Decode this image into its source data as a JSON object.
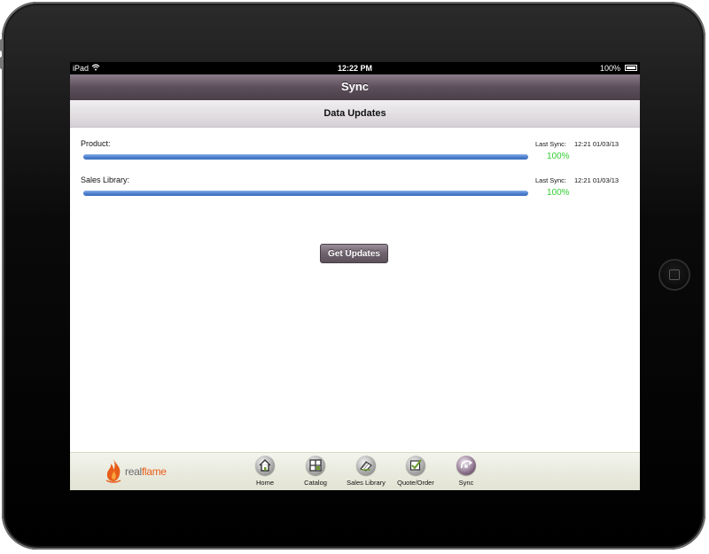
{
  "status_bar": {
    "device": "iPad",
    "time": "12:22 PM",
    "battery": "100%"
  },
  "nav": {
    "title": "Sync"
  },
  "section": {
    "title": "Data Updates"
  },
  "sync_items": [
    {
      "label": "Product:",
      "last_sync_label": "Last Sync:",
      "last_sync_time": "12:21 01/03/13",
      "percent": "100%",
      "progress": 100
    },
    {
      "label": "Sales Library:",
      "last_sync_label": "Last Sync:",
      "last_sync_time": "12:21 01/03/13",
      "percent": "100%",
      "progress": 100
    }
  ],
  "actions": {
    "get_updates": "Get Updates"
  },
  "brand": {
    "name_part1": "real",
    "name_part2": "flame"
  },
  "tabs": [
    {
      "label": "Home",
      "icon": "home-icon"
    },
    {
      "label": "Catalog",
      "icon": "grid-icon"
    },
    {
      "label": "Sales Library",
      "icon": "books-icon"
    },
    {
      "label": "Quote/Order",
      "icon": "checkmark-icon"
    },
    {
      "label": "Sync",
      "icon": "sync-icon"
    }
  ],
  "colors": {
    "nav_bar": "#5c4f5b",
    "progress": "#4f82d1",
    "percent_text": "#33cc33",
    "brand_accent": "#e85d1a"
  }
}
